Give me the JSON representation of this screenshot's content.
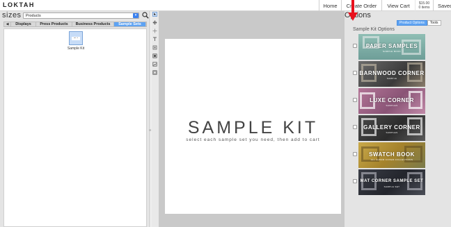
{
  "header": {
    "logo": "LOKTAH",
    "nav": [
      {
        "label": "Home"
      },
      {
        "label": "Create Order"
      },
      {
        "label": "View Cart"
      }
    ],
    "cart_total": "$15.00",
    "cart_items": "0 items",
    "saved_label": "Saved Orders"
  },
  "left_panel": {
    "title": "sizes",
    "product_select": "Products",
    "back_label": "◀",
    "tabs": [
      {
        "label": "Displays"
      },
      {
        "label": "Press Products"
      },
      {
        "label": "Business Products"
      },
      {
        "label": "Sample Sets"
      }
    ],
    "products": [
      {
        "name": "Sample Kit",
        "thumb_text": "smt . k"
      }
    ]
  },
  "canvas": {
    "title": "SAMPLE KIT",
    "subtitle": "select each sample set you need, then add to cart"
  },
  "right_panel": {
    "title": "Options",
    "tabs": [
      {
        "label": "Product Options"
      },
      {
        "label": "Tools"
      }
    ],
    "section_label": "Sample Kit Options",
    "samples": [
      {
        "name": "PAPER SAMPLES",
        "tag": "SAMPLE BOOK"
      },
      {
        "name": "BARNWOOD CORNER",
        "tag": "SAMPLE"
      },
      {
        "name": "LUXE CORNER",
        "tag": "SAMPLES"
      },
      {
        "name": "GALLERY CORNER",
        "tag": "SAMPLES"
      },
      {
        "name": "SWATCH BOOK",
        "tag": "ALL ALBUM COVER COLLECTIONS"
      },
      {
        "name": "MAT CORNER SAMPLE SET",
        "tag": "SAMPLE SET"
      }
    ]
  },
  "colors": {
    "accent": "#5ea3f3",
    "arrow": "#e8101c",
    "banner_paper": "#7fb0a8",
    "banner_barnwood": "#4a4a4a",
    "banner_luxe": "#a06a8a",
    "banner_gallery": "#3a3a3a",
    "banner_swatch": "#b89a3a",
    "banner_mat": "#2e3038"
  }
}
